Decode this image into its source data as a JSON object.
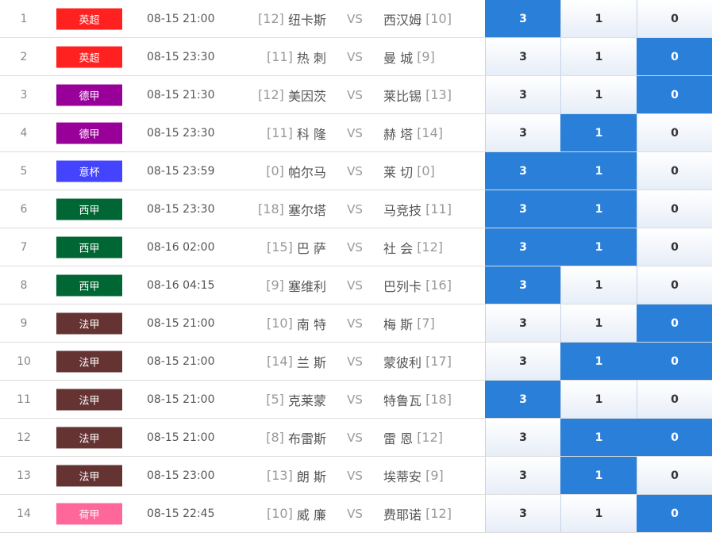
{
  "vs_label": "VS",
  "colors": {
    "selected_odd": "#2a7fd8",
    "英超": "#ff2020",
    "德甲": "#990099",
    "意杯": "#4444ff",
    "西甲": "#006633",
    "法甲": "#663333",
    "荷甲": "#ff6699"
  },
  "matches": [
    {
      "num": "1",
      "league": "英超",
      "league_color": "#ff2020",
      "time": "08-15 21:00",
      "home_rank": "[12]",
      "home": "纽卡斯",
      "away": "西汉姆",
      "away_rank": "[10]",
      "odds": [
        "3",
        "1",
        "0"
      ],
      "selected": [
        true,
        false,
        false
      ]
    },
    {
      "num": "2",
      "league": "英超",
      "league_color": "#ff2020",
      "time": "08-15 23:30",
      "home_rank": "[11]",
      "home": "热 刺",
      "away": "曼 城",
      "away_rank": "[9]",
      "odds": [
        "3",
        "1",
        "0"
      ],
      "selected": [
        false,
        false,
        true
      ]
    },
    {
      "num": "3",
      "league": "德甲",
      "league_color": "#990099",
      "time": "08-15 21:30",
      "home_rank": "[12]",
      "home": "美因茨",
      "away": "莱比锡",
      "away_rank": "[13]",
      "odds": [
        "3",
        "1",
        "0"
      ],
      "selected": [
        false,
        false,
        true
      ]
    },
    {
      "num": "4",
      "league": "德甲",
      "league_color": "#990099",
      "time": "08-15 23:30",
      "home_rank": "[11]",
      "home": "科 隆",
      "away": "赫 塔",
      "away_rank": "[14]",
      "odds": [
        "3",
        "1",
        "0"
      ],
      "selected": [
        false,
        true,
        false
      ]
    },
    {
      "num": "5",
      "league": "意杯",
      "league_color": "#4444ff",
      "time": "08-15 23:59",
      "home_rank": "[0]",
      "home": "帕尔马",
      "away": "莱 切",
      "away_rank": "[0]",
      "odds": [
        "3",
        "1",
        "0"
      ],
      "selected": [
        true,
        true,
        false
      ]
    },
    {
      "num": "6",
      "league": "西甲",
      "league_color": "#006633",
      "time": "08-15 23:30",
      "home_rank": "[18]",
      "home": "塞尔塔",
      "away": "马竞技",
      "away_rank": "[11]",
      "odds": [
        "3",
        "1",
        "0"
      ],
      "selected": [
        true,
        true,
        false
      ]
    },
    {
      "num": "7",
      "league": "西甲",
      "league_color": "#006633",
      "time": "08-16 02:00",
      "home_rank": "[15]",
      "home": "巴 萨",
      "away": "社 会",
      "away_rank": "[12]",
      "odds": [
        "3",
        "1",
        "0"
      ],
      "selected": [
        true,
        true,
        false
      ]
    },
    {
      "num": "8",
      "league": "西甲",
      "league_color": "#006633",
      "time": "08-16 04:15",
      "home_rank": "[9]",
      "home": "塞维利",
      "away": "巴列卡",
      "away_rank": "[16]",
      "odds": [
        "3",
        "1",
        "0"
      ],
      "selected": [
        true,
        false,
        false
      ]
    },
    {
      "num": "9",
      "league": "法甲",
      "league_color": "#663333",
      "time": "08-15 21:00",
      "home_rank": "[10]",
      "home": "南 特",
      "away": "梅 斯",
      "away_rank": "[7]",
      "odds": [
        "3",
        "1",
        "0"
      ],
      "selected": [
        false,
        false,
        true
      ]
    },
    {
      "num": "10",
      "league": "法甲",
      "league_color": "#663333",
      "time": "08-15 21:00",
      "home_rank": "[14]",
      "home": "兰 斯",
      "away": "蒙彼利",
      "away_rank": "[17]",
      "odds": [
        "3",
        "1",
        "0"
      ],
      "selected": [
        false,
        true,
        true
      ]
    },
    {
      "num": "11",
      "league": "法甲",
      "league_color": "#663333",
      "time": "08-15 21:00",
      "home_rank": "[5]",
      "home": "克莱蒙",
      "away": "特鲁瓦",
      "away_rank": "[18]",
      "odds": [
        "3",
        "1",
        "0"
      ],
      "selected": [
        true,
        false,
        false
      ]
    },
    {
      "num": "12",
      "league": "法甲",
      "league_color": "#663333",
      "time": "08-15 21:00",
      "home_rank": "[8]",
      "home": "布雷斯",
      "away": "雷 恩",
      "away_rank": "[12]",
      "odds": [
        "3",
        "1",
        "0"
      ],
      "selected": [
        false,
        true,
        true
      ]
    },
    {
      "num": "13",
      "league": "法甲",
      "league_color": "#663333",
      "time": "08-15 23:00",
      "home_rank": "[13]",
      "home": "朗 斯",
      "away": "埃蒂安",
      "away_rank": "[9]",
      "odds": [
        "3",
        "1",
        "0"
      ],
      "selected": [
        false,
        true,
        false
      ]
    },
    {
      "num": "14",
      "league": "荷甲",
      "league_color": "#ff6699",
      "time": "08-15 22:45",
      "home_rank": "[10]",
      "home": "威 廉",
      "away": "费耶诺",
      "away_rank": "[12]",
      "odds": [
        "3",
        "1",
        "0"
      ],
      "selected": [
        false,
        false,
        true
      ]
    }
  ]
}
